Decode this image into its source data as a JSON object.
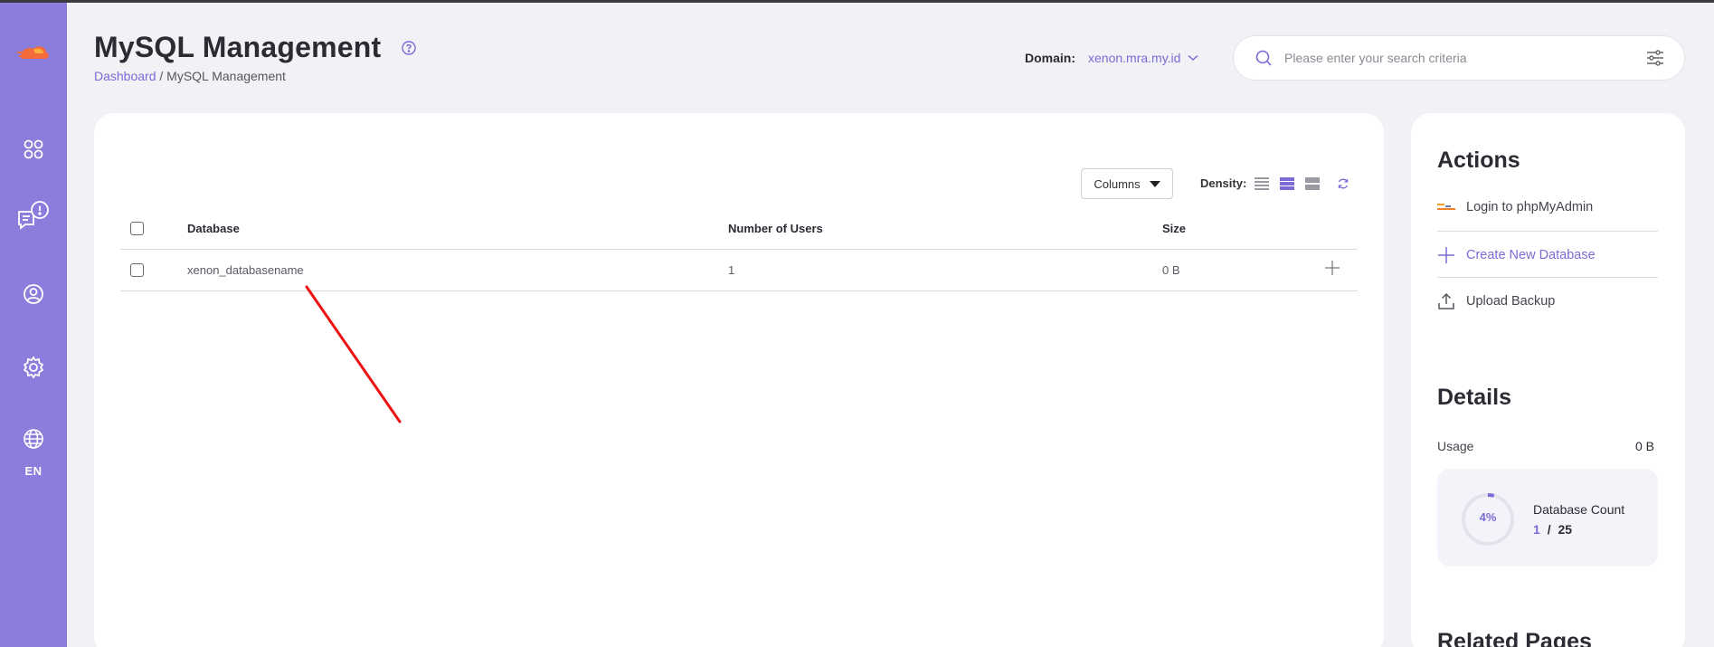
{
  "header": {
    "title": "MySQL Management",
    "breadcrumb": {
      "home": "Dashboard",
      "separator": "/",
      "current": "MySQL Management"
    },
    "domain_label": "Domain:",
    "domain_value": "xenon.mra.my.id",
    "search_placeholder": "Please enter your search criteria"
  },
  "sidebar": {
    "items": [
      {
        "icon": "logo-icon"
      },
      {
        "icon": "apps-grid-icon"
      },
      {
        "icon": "notifications-chat-icon"
      },
      {
        "icon": "user-profile-icon"
      },
      {
        "icon": "settings-gear-icon"
      },
      {
        "icon": "globe-icon"
      }
    ],
    "language": "EN",
    "accent": "#8b7ddc"
  },
  "toolbar": {
    "columns_label": "Columns",
    "density_label": "Density:"
  },
  "table": {
    "headers": [
      "Database",
      "Number of Users",
      "Size"
    ],
    "rows": [
      {
        "database": "xenon_databasename",
        "users": "1",
        "size": "0 B"
      }
    ]
  },
  "actions": {
    "title": "Actions",
    "items": [
      {
        "label": "Login to phpMyAdmin",
        "icon": "phpmyadmin-icon"
      },
      {
        "label": "Create New Database",
        "icon": "plus-icon"
      },
      {
        "label": "Upload Backup",
        "icon": "upload-icon"
      }
    ]
  },
  "details": {
    "title": "Details",
    "usage_label": "Usage",
    "usage_value": "0 B",
    "count_percent": "4%",
    "count_percent_value": 4,
    "count_label": "Database Count",
    "count_used": "1",
    "count_sep": "/",
    "count_total": "25"
  },
  "related": {
    "title": "Related Pages"
  },
  "colors": {
    "accent": "#7a6bd6",
    "annotation": "#ee1111"
  }
}
